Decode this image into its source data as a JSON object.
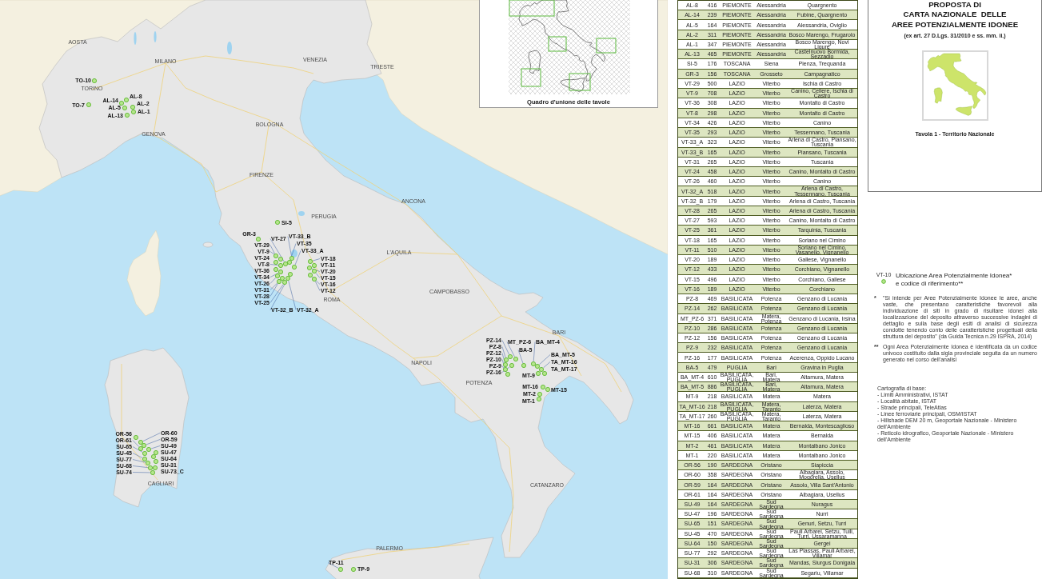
{
  "map": {
    "cities": [
      "AOSTA",
      "MILANO",
      "VENEZIA",
      "TRIESTE",
      "TORINO",
      "GENOVA",
      "BOLOGNA",
      "FIRENZE",
      "ANCONA",
      "PERUGIA",
      "L'AQUILA",
      "ROMA",
      "CAMPOBASSO",
      "NAPOLI",
      "BARI",
      "POTENZA",
      "CATANZARO",
      "PALERMO",
      "CAGLIARI"
    ],
    "sites": [
      "TO-10",
      "TO-7",
      "AL-14",
      "AL-8",
      "AL-5",
      "AL-2",
      "AL-1",
      "AL-13",
      "SI-5",
      "GR-3",
      "VT-29",
      "VT-9",
      "VT-24",
      "VT-8",
      "VT-36",
      "VT-34",
      "VT-26",
      "VT-31",
      "VT-28",
      "VT-25",
      "VT-33_B",
      "VT-35",
      "VT-27",
      "VT-33_A",
      "VT-32_B",
      "VT-32_A",
      "VT-18",
      "VT-11",
      "VT-20",
      "VT-15",
      "VT-16",
      "VT-12",
      "PZ-14",
      "MT_PZ-6",
      "PZ-8",
      "BA_MT-4",
      "BA-5",
      "BA_MT-5",
      "PZ-12",
      "TA_MT-16",
      "PZ-10",
      "PZ-16",
      "MT-9",
      "TA_MT-17",
      "PZ-9",
      "MT-16",
      "MT-15",
      "MT-2",
      "MT-1",
      "OR-56",
      "OR-60",
      "OR-59",
      "OR-61",
      "SU-49",
      "SU-47",
      "SU-65",
      "SU-64",
      "SU-45",
      "SU-31",
      "SU-77",
      "SU-68",
      "SU-73_C",
      "SU-74",
      "TP-11",
      "TP-9"
    ]
  },
  "index_map": {
    "caption": "Quadro d'unione delle tavole"
  },
  "table": {
    "rows": [
      [
        "AL-8",
        "416",
        "PIEMONTE",
        "Alessandria",
        "Quargnento"
      ],
      [
        "AL-14",
        "239",
        "PIEMONTE",
        "Alessandria",
        "Fubine, Quargnento"
      ],
      [
        "AL-5",
        "164",
        "PIEMONTE",
        "Alessandria",
        "Alessandria, Oviglio"
      ],
      [
        "AL-2",
        "311",
        "PIEMONTE",
        "Alessandria",
        "Bosco Marengo, Frugarolo"
      ],
      [
        "AL-1",
        "347",
        "PIEMONTE",
        "Alessandria",
        "Bosco Marengo, Novi Ligure"
      ],
      [
        "AL-13",
        "465",
        "PIEMONTE",
        "Alessandria",
        "Castelnuovo Bormida, Sezzadio"
      ],
      [
        "SI-5",
        "176",
        "TOSCANA",
        "Siena",
        "Pienza, Trequanda"
      ],
      [
        "GR-3",
        "156",
        "TOSCANA",
        "Grosseto",
        "Campagnatico"
      ],
      [
        "VT-29",
        "500",
        "LAZIO",
        "Viterbo",
        "Ischia di Castro"
      ],
      [
        "VT-9",
        "708",
        "LAZIO",
        "Viterbo",
        "Canino, Cellere, Ischia di Castro"
      ],
      [
        "VT-36",
        "308",
        "LAZIO",
        "Viterbo",
        "Montalto di Castro"
      ],
      [
        "VT-8",
        "298",
        "LAZIO",
        "Viterbo",
        "Montalto di Castro"
      ],
      [
        "VT-34",
        "426",
        "LAZIO",
        "Viterbo",
        "Canino"
      ],
      [
        "VT-35",
        "293",
        "LAZIO",
        "Viterbo",
        "Tessennano, Tuscania"
      ],
      [
        "VT-33_A",
        "323",
        "LAZIO",
        "Viterbo",
        "Arlena di Castro, Piansano, Tuscania"
      ],
      [
        "VT-33_B",
        "165",
        "LAZIO",
        "Viterbo",
        "Piansano, Tuscania"
      ],
      [
        "VT-31",
        "265",
        "LAZIO",
        "Viterbo",
        "Tuscania"
      ],
      [
        "VT-24",
        "458",
        "LAZIO",
        "Viterbo",
        "Canino, Montalto di Castro"
      ],
      [
        "VT-26",
        "460",
        "LAZIO",
        "Viterbo",
        "Canino"
      ],
      [
        "VT-32_A",
        "518",
        "LAZIO",
        "Viterbo",
        "Arlena di Castro, Tessennano, Tuscania"
      ],
      [
        "VT-32_B",
        "179",
        "LAZIO",
        "Viterbo",
        "Arlena di Castro, Tuscania"
      ],
      [
        "VT-28",
        "265",
        "LAZIO",
        "Viterbo",
        "Arlena di Castro, Tuscania"
      ],
      [
        "VT-27",
        "593",
        "LAZIO",
        "Viterbo",
        "Canino, Montalto di Castro"
      ],
      [
        "VT-25",
        "361",
        "LAZIO",
        "Viterbo",
        "Tarquinia, Tuscania"
      ],
      [
        "VT-18",
        "165",
        "LAZIO",
        "Viterbo",
        "Soriano nel Cimino"
      ],
      [
        "VT-11",
        "510",
        "LAZIO",
        "Viterbo",
        "Soriano nel Cimino, Vasanello, Vignanello"
      ],
      [
        "VT-20",
        "189",
        "LAZIO",
        "Viterbo",
        "Gallese, Vignanello"
      ],
      [
        "VT-12",
        "433",
        "LAZIO",
        "Viterbo",
        "Corchiano, Vignanello"
      ],
      [
        "VT-15",
        "496",
        "LAZIO",
        "Viterbo",
        "Corchiano, Gallese"
      ],
      [
        "VT-16",
        "189",
        "LAZIO",
        "Viterbo",
        "Corchiano"
      ],
      [
        "PZ-8",
        "469",
        "BASILICATA",
        "Potenza",
        "Genzano di Lucania"
      ],
      [
        "PZ-14",
        "262",
        "BASILICATA",
        "Potenza",
        "Genzano di Lucania"
      ],
      [
        "MT_PZ-6",
        "371",
        "BASILICATA",
        "Matera, Potenza",
        "Genzano di Lucania, Irsina"
      ],
      [
        "PZ-10",
        "286",
        "BASILICATA",
        "Potenza",
        "Genzano di Lucania"
      ],
      [
        "PZ-12",
        "156",
        "BASILICATA",
        "Potenza",
        "Genzano di Lucania"
      ],
      [
        "PZ-9",
        "232",
        "BASILICATA",
        "Potenza",
        "Genzano di Lucania"
      ],
      [
        "PZ-16",
        "177",
        "BASILICATA",
        "Potenza",
        "Acerenza, Oppido Lucano"
      ],
      [
        "BA-5",
        "479",
        "PUGLIA",
        "Bari",
        "Gravina in Puglia"
      ],
      [
        "BA_MT-4",
        "610",
        "BASILICATA, PUGLIA",
        "Bari, Matera",
        "Altamura, Matera"
      ],
      [
        "BA_MT-5",
        "886",
        "BASILICATA, PUGLIA",
        "Bari, Matera",
        "Altamura, Matera"
      ],
      [
        "MT-9",
        "218",
        "BASILICATA",
        "Matera",
        "Matera"
      ],
      [
        "TA_MT-16",
        "218",
        "BASILICATA, PUGLIA",
        "Matera, Taranto",
        "Laterza, Matera"
      ],
      [
        "TA_MT-17",
        "260",
        "BASILICATA, PUGLIA",
        "Matera, Taranto",
        "Laterza, Matera"
      ],
      [
        "MT-16",
        "661",
        "BASILICATA",
        "Matera",
        "Bernalda, Montescaglioso"
      ],
      [
        "MT-15",
        "406",
        "BASILICATA",
        "Matera",
        "Bernalda"
      ],
      [
        "MT-2",
        "461",
        "BASILICATA",
        "Matera",
        "Montalbano Jonico"
      ],
      [
        "MT-1",
        "220",
        "BASILICATA",
        "Matera",
        "Montalbano Jonico"
      ],
      [
        "OR-56",
        "190",
        "SARDEGNA",
        "Oristano",
        "Siapiccia"
      ],
      [
        "OR-60",
        "358",
        "SARDEGNA",
        "Oristano",
        "Albagiara, Assolo, Mogorella, Usellus"
      ],
      [
        "OR-59",
        "164",
        "SARDEGNA",
        "Oristano",
        "Assolo, Villa Sant'Antonio"
      ],
      [
        "OR-61",
        "164",
        "SARDEGNA",
        "Oristano",
        "Albagiara, Usellus"
      ],
      [
        "SU-49",
        "164",
        "SARDEGNA",
        "Sud Sardegna",
        "Nuragus"
      ],
      [
        "SU-47",
        "196",
        "SARDEGNA",
        "Sud Sardegna",
        "Nurri"
      ],
      [
        "SU-65",
        "151",
        "SARDEGNA",
        "Sud Sardegna",
        "Genuri, Setzu, Turri"
      ],
      [
        "SU-45",
        "470",
        "SARDEGNA",
        "Sud Sardegna",
        "Pauli Arbarei, Setzu, Tuili, Turri, Ussaramanna"
      ],
      [
        "SU-64",
        "150",
        "SARDEGNA",
        "Sud Sardegna",
        "Gergei"
      ],
      [
        "SU-77",
        "292",
        "SARDEGNA",
        "Sud Sardegna",
        "Las Plassas, Pauli Arbarei, Villamar"
      ],
      [
        "SU-31",
        "306",
        "SARDEGNA",
        "Sud Sardegna",
        "Mandas, Siurgus Donigala"
      ],
      [
        "SU-68",
        "310",
        "SARDEGNA",
        "Sud Sardegna",
        "Segariu, Villamar"
      ]
    ]
  },
  "title_block": {
    "title": [
      "PROPOSTA DI",
      "CARTA NAZIONALE  DELLE",
      "AREE POTENZIALMENTE IDONEE"
    ],
    "subtitle": "(ex art. 27 D.Lgs. 31/2010 e ss. mm. ii.)",
    "sheet": "Tavola 1 - Territorio Nazionale"
  },
  "legend": {
    "sample_code": "VT-10",
    "label": [
      "Ubicazione Area Potenzialmente Idonea*",
      "e codice di riferimento**"
    ],
    "notes": [
      {
        "mark": "*",
        "text": "\"Si intende per Aree Potenzialmente Idonee le aree, anche vaste, che presentano caratteristiche favorevoli alla individuazione di siti in grado di risultare idonei alla localizzazione del deposito attraverso successive indagini di dettaglio e sulla base degli esiti di analisi di sicurezza condotte tenendo conto delle caratteristiche progettuali della struttura del deposito\" (da Guida Tecnica n.29 ISPRA, 2014)"
      },
      {
        "mark": "**",
        "text": "Ogni Area Potenzialmente Idonea è identificata da un codice univoco costituito dalla sigla provinciale seguita da un numero generato nel corso dell'analisi"
      }
    ],
    "base_map": {
      "title": "Cartografia di base:",
      "items": [
        "- Limiti Amministrativi, ISTAT",
        "- Località abitate, ISTAT",
        "- Strade principali, TeleAtlas",
        "- Linee ferroviarie principali, OSM/ISTAT",
        "- Hillshade DEM 20 m, Geoportale Nazionale - Ministero dell'Ambiente",
        "- Reticolo idrografico, Geoportale Nazionale - Ministero dell'Ambiente"
      ]
    }
  }
}
